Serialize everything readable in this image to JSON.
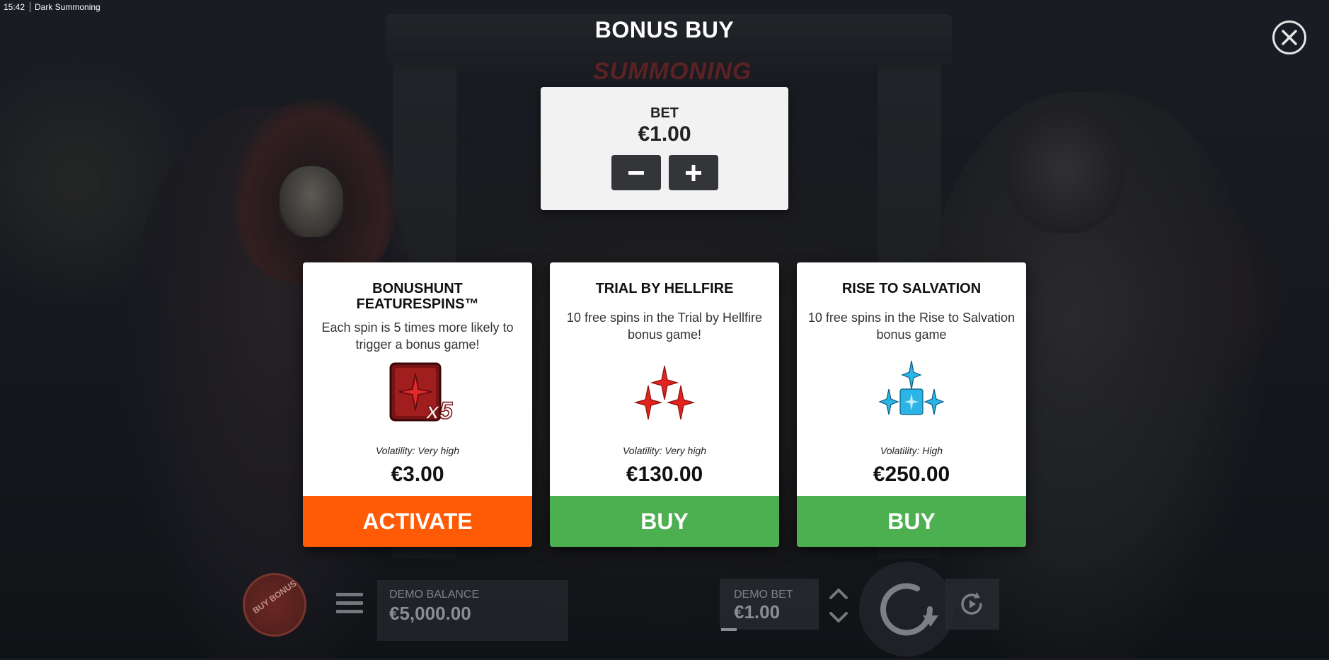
{
  "status_bar": {
    "time": "15:42",
    "app_title": "Dark Summoning"
  },
  "game_logo": "SUMMONING",
  "modal": {
    "title": "BONUS BUY",
    "close_icon": "close-icon"
  },
  "bet": {
    "label": "BET",
    "value": "€1.00",
    "decrease_icon": "minus-icon",
    "increase_icon": "plus-icon"
  },
  "cards": [
    {
      "title": "BONUSHUNT FEATURESPINS™",
      "description": "Each spin is 5 times more likely to trigger a bonus game!",
      "icon": "x5-multiplier-icon",
      "volatility": "Volatility: Very high",
      "price": "€3.00",
      "button": "ACTIVATE",
      "button_color": "#ff5a05"
    },
    {
      "title": "TRIAL BY HELLFIRE",
      "description": "10 free spins in the Trial by Hellfire bonus game!",
      "icon": "red-crosses-icon",
      "volatility": "Volatility: Very high",
      "price": "€130.00",
      "button": "BUY",
      "button_color": "#4caf50"
    },
    {
      "title": "RISE TO SALVATION",
      "description": "10 free spins in the Rise to Salvation bonus game",
      "icon": "blue-crosses-icon",
      "volatility": "Volatility: High",
      "price": "€250.00",
      "button": "BUY",
      "button_color": "#4caf50"
    }
  ],
  "bottom_bar": {
    "buy_bonus": "BUY BONUS",
    "menu_icon": "hamburger-menu-icon",
    "balance_label": "DEMO BALANCE",
    "balance_value": "€5,000.00",
    "bet_label": "DEMO BET",
    "bet_value": "€1.00",
    "spin_icon": "spin-icon",
    "autoplay_icon": "autoplay-icon"
  }
}
